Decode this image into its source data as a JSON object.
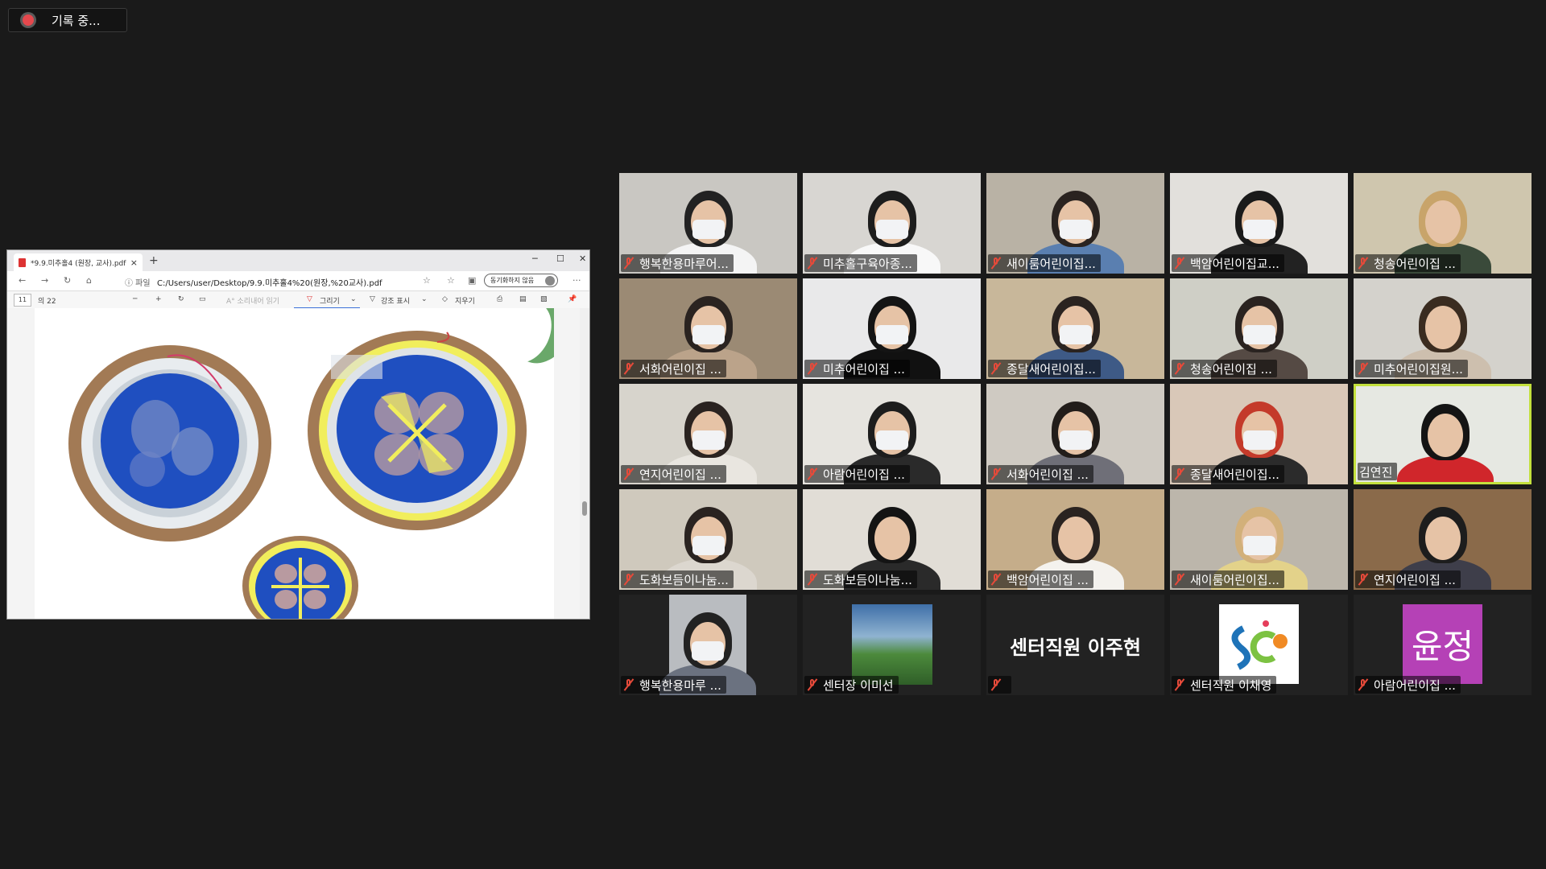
{
  "recording": {
    "label": "기록 중..."
  },
  "browser": {
    "tab_title": "*9.9.미추홀4 (원장, 교사).pdf",
    "tab_close": "×",
    "new_tab": "+",
    "window_controls": [
      "─",
      "☐",
      "✕"
    ],
    "file_label": "ⓘ 파일",
    "url": "C:/Users/user/Desktop/9.9.미추홀4%20(원장,%20교사).pdf",
    "sync_label": "동기화하지 않음",
    "menu": "···",
    "pdf_toolbar": {
      "page": "11",
      "of_total": "의 22",
      "zoom_out": "─",
      "zoom_in": "+",
      "read_aloud": "A° 소리내어 읽기",
      "draw": "그리기",
      "highlight": "강조 표시",
      "erase": "지우기"
    }
  },
  "participants": [
    {
      "name": "행복한용마루어...",
      "muted": true,
      "active": false,
      "bg": "#c9c7c2",
      "shirt": "#f4f4f4",
      "hair": "#222"
    },
    {
      "name": "미추홀구육아종...",
      "muted": true,
      "active": false,
      "bg": "#d8d6d2",
      "shirt": "#f8f8f8",
      "hair": "#1d1d1d"
    },
    {
      "name": "새이룸어린이집...",
      "muted": true,
      "active": false,
      "bg": "#b9b2a5",
      "shirt": "#5a7fb0",
      "hair": "#2a2320"
    },
    {
      "name": "백암어린이집교...",
      "muted": true,
      "active": false,
      "bg": "#e2e0dc",
      "shirt": "#222",
      "hair": "#1a1a1a"
    },
    {
      "name": "청송어린이집 ...",
      "muted": true,
      "active": false,
      "bg": "#cfc6ae",
      "shirt": "#3a4a3a",
      "hair": "#c8a46a"
    },
    {
      "name": "서화어린이집 ...",
      "muted": true,
      "active": false,
      "bg": "#9b8a74",
      "shirt": "#bba38a",
      "hair": "#2a2320"
    },
    {
      "name": "미추어린이집 ...",
      "muted": true,
      "active": false,
      "bg": "#e9e9ea",
      "shirt": "#111",
      "hair": "#141414"
    },
    {
      "name": "종달새어린이집...",
      "muted": true,
      "active": false,
      "bg": "#c8b79a",
      "shirt": "#3e5a86",
      "hair": "#2a2320"
    },
    {
      "name": "청송어린이집 ...",
      "muted": true,
      "active": false,
      "bg": "#cfcfc6",
      "shirt": "#554a44",
      "hair": "#2a2320"
    },
    {
      "name": "미추어린이집원...",
      "muted": true,
      "active": false,
      "bg": "#d4d2cc",
      "shirt": "#cdbfae",
      "hair": "#3a2c20"
    },
    {
      "name": "연지어린이집 ...",
      "muted": true,
      "active": false,
      "bg": "#d7d4cc",
      "shirt": "#e9e6e0",
      "hair": "#2a2320"
    },
    {
      "name": "아람어린이집 ...",
      "muted": true,
      "active": false,
      "bg": "#e6e4df",
      "shirt": "#2a2a2a",
      "hair": "#1d1d1d"
    },
    {
      "name": "서화어린이집 ...",
      "muted": true,
      "active": false,
      "bg": "#cfcac2",
      "shirt": "#6f6f78",
      "hair": "#221d1a"
    },
    {
      "name": "종달새어린이집...",
      "muted": true,
      "active": false,
      "bg": "#d9c8b8",
      "shirt": "#2b2b2b",
      "hair": "#c43a2a"
    },
    {
      "name": "김연진",
      "muted": false,
      "active": true,
      "bg": "#e6e8e2",
      "shirt": "#d0262b",
      "hair": "#141414"
    },
    {
      "name": "도화보듬이나눔...",
      "muted": true,
      "active": false,
      "bg": "#cfc9bd",
      "shirt": "#dcd7cf",
      "hair": "#2a2320"
    },
    {
      "name": "도화보듬이나눔...",
      "muted": true,
      "active": false,
      "bg": "#e1ddd6",
      "shirt": "#2a2a2a",
      "hair": "#141414"
    },
    {
      "name": "백암어린이집 ...",
      "muted": true,
      "active": false,
      "bg": "#c5ad8a",
      "shirt": "#f4f2ee",
      "hair": "#2a2320"
    },
    {
      "name": "새이룸어린이집...",
      "muted": true,
      "active": false,
      "bg": "#bcb6ab",
      "shirt": "#e3d28a",
      "hair": "#d2b07a"
    },
    {
      "name": "연지어린이집 ...",
      "muted": true,
      "active": false,
      "bg": "#8a6a4a",
      "shirt": "#3e3e4a",
      "hair": "#1d1d1d"
    },
    {
      "name": "행복한용마루 ...",
      "muted": true,
      "active": false,
      "kind": "small-video",
      "bg": "#b9bcc0",
      "shirt": "#6b7280",
      "hair": "#222"
    },
    {
      "name": "센터장 이미선",
      "muted": true,
      "active": false,
      "kind": "photo"
    },
    {
      "name": "",
      "display": "센터직원 이주현",
      "muted": true,
      "active": false,
      "kind": "text"
    },
    {
      "name": "센터직원 이채영",
      "muted": true,
      "active": false,
      "kind": "logo"
    },
    {
      "name": "아람어린이집 ...",
      "muted": true,
      "active": false,
      "kind": "avatar",
      "avatar": "윤정",
      "avatar_color": "#b541b6"
    }
  ]
}
